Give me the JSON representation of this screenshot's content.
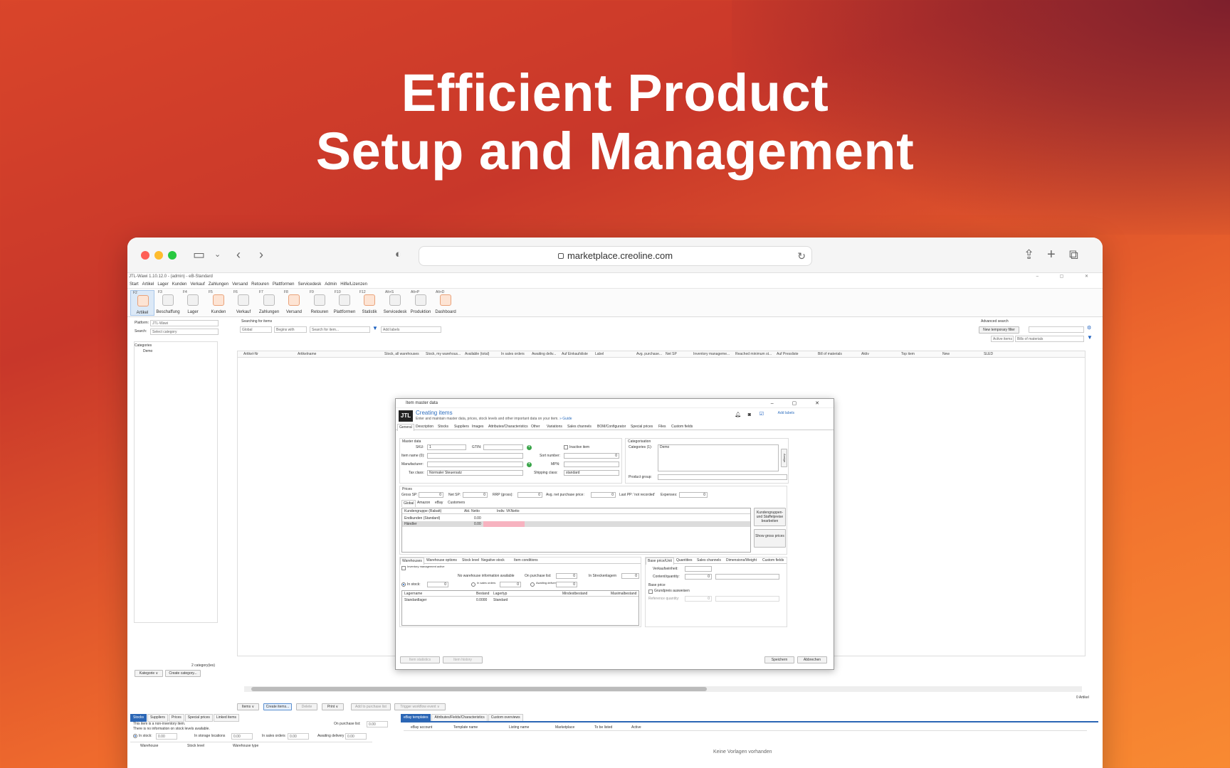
{
  "headline": {
    "line1": "Efficient Product",
    "line2": "Setup and Management"
  },
  "browser": {
    "url": "marketplace.creoline.com"
  },
  "app": {
    "title": "JTL-Wawi 1.10.12.0 - (admin) - eB-Standard",
    "window_controls": "– ▢ ✕",
    "menu": [
      "Start",
      "Artikel",
      "Lager",
      "Kunden",
      "Verkauf",
      "Zahlungen",
      "Versand",
      "Retouren",
      "Plattformen",
      "Servicedesk",
      "Admin",
      "Hilfe/Lizenzen"
    ],
    "ribbon": [
      {
        "key": "F2",
        "label": "Artikel"
      },
      {
        "key": "F3",
        "label": "Beschaffung"
      },
      {
        "key": "F4",
        "label": "Lager"
      },
      {
        "key": "F5",
        "label": "Kunden"
      },
      {
        "key": "F6",
        "label": "Verkauf"
      },
      {
        "key": "F7",
        "label": "Zahlungen"
      },
      {
        "key": "F8",
        "label": "Versand"
      },
      {
        "key": "F9",
        "label": "Retouren"
      },
      {
        "key": "F10",
        "label": "Plattformen"
      },
      {
        "key": "F12",
        "label": "Statistik"
      },
      {
        "key": "Alt+S",
        "label": "Servicedesk"
      },
      {
        "key": "Alt+P",
        "label": "Produktion"
      },
      {
        "key": "Alt+D",
        "label": "Dashboard"
      }
    ],
    "left": {
      "platform_label": "Platform:",
      "platform_value": "JTL-Wawi",
      "search_label": "Search:",
      "search_placeholder": "Select category",
      "categories_header": "Categories",
      "category_item": "Demo",
      "count": "2 category(ies)",
      "btn_kategorie": "Kategorie ∨",
      "btn_create_category": "Create category..."
    },
    "search": {
      "title": "Searching for items",
      "scope": "Global",
      "mode": "Begins with",
      "placeholder": "Search for item...",
      "labels_placeholder": "Add labels",
      "advanced": "Advanced search",
      "temp_filter": "New temporary filter",
      "active_items": "Active items",
      "bills": "Bills of materials"
    },
    "columns": [
      "Artikel-Nr",
      "Artikelname",
      "Stock, all warehouses",
      "Stock, my warehous...",
      "Available (total)",
      "In sales orders",
      "Awaiting deliv...",
      "Auf Einkaufsliste",
      "Label",
      "Avg. purchase...",
      "Net SP",
      "Inventory manageme...",
      "Reached minimum st...",
      "Auf Pressliste",
      "Bill of materials",
      "Aktiv",
      "Top item",
      "New",
      "SLED"
    ],
    "toolbar": {
      "items": "Items ∨",
      "create": "Create items...",
      "delete": "Delete",
      "print": "Print ∨",
      "add_list": "Add to purchase list",
      "workflow": "Trigger workflow event ∨",
      "count": "0 Artikel"
    },
    "dialog": {
      "title": "Item master data",
      "controls": "– ▢ ✕",
      "heading": "Creating items",
      "subtitle": "Enter and maintain master data, prices, stock levels and other important data on your item.",
      "guide": "» Guide",
      "add_labels": "Add labels",
      "tabs": [
        "General",
        "Description",
        "Stocks",
        "Suppliers",
        "Images",
        "Attributes/Characteristics",
        "Other",
        "Variations",
        "Sales channels",
        "BOM/Configurator",
        "Special prices",
        "Files",
        "Custom fields"
      ],
      "master": {
        "title": "Master data",
        "sku_label": "SKU:",
        "sku": "1",
        "gtin_label": "GTIN:",
        "inactive": "Inactive item",
        "name_label": "Item name (0):",
        "sort_label": "Sort number:",
        "sort": "0",
        "manufacturer_label": "Manufacturer:",
        "mpn_label": "MPN:",
        "tax_label": "Tax class:",
        "tax": "Normaler Steuersatz",
        "shipping_label": "Shipping class:",
        "shipping": "standard"
      },
      "categorisation": {
        "title": "Categorisation",
        "categories_label": "Categories (1):",
        "category": "Demo",
        "assign": "Assign",
        "group_label": "Product group:"
      },
      "prices": {
        "title": "Prices",
        "gross_label": "Gross SP:",
        "gross": "0",
        "net_label": "Net SP:",
        "net": "0",
        "rrp_label": "RRP (gross):",
        "rrp": "0",
        "avg_label": "Avg. net purchase price:",
        "avg": "0",
        "lastpp_label": "Last PP: 'not recorded'",
        "exp_label": "Expenses:",
        "exp": "0",
        "subtabs": [
          "Global",
          "Amazon",
          "eBay",
          "Customers"
        ],
        "table_cols": [
          "Kundengruppe (Rabatt)",
          "Akt. Netto",
          "Indiv. VKNetto"
        ],
        "rows": [
          {
            "name": "Endkunden (Standard)",
            "val": "0.00"
          },
          {
            "name": "Händler",
            "val": "0.00"
          }
        ],
        "btn_groups": "Kundengruppen- und Staffelpreise bearbeiten",
        "btn_gross": "Show gross prices"
      },
      "stock": {
        "tabs": [
          "Warehouses",
          "Warehouse options",
          "Stock level",
          "Negative stock",
          "Item conditions"
        ],
        "inventory_active": "Inventory management active",
        "no_info": "No warehouse information available",
        "on_purchase_label": "On purchase list:",
        "on_purchase": "0",
        "in_stock_label": "In stock:",
        "in_stock": "0",
        "in_sales_label": "In sales orders",
        "in_sales": "0",
        "awaiting_label": "Awaiting delivery",
        "awaiting": "0",
        "strecken_label": "In Streckenlagern",
        "strecken": "0",
        "cols": [
          "Lagername",
          "Bestand",
          "Lagertyp",
          "Mindestbestand",
          "Maximalbestand"
        ],
        "row": {
          "name": "Standardlager",
          "bestand": "0.0000",
          "typ": "Standard"
        }
      },
      "baseprice": {
        "tabs": [
          "Base price/Unit",
          "Quantities",
          "Sales channels",
          "Dimensions/Weight",
          "Custom fields"
        ],
        "unit_label": "Verkaufseinheit:",
        "content_label": "Content/quantity:",
        "content": "0",
        "base_title": "Base price",
        "show": "Grundpreis ausweisen",
        "ref_label": "Reference quantity:",
        "ref": "0"
      },
      "footer": {
        "stats": "Item statistics",
        "history": "Item history",
        "save": "Speichern",
        "cancel": "Abbrechen"
      }
    },
    "bottom_left": {
      "tabs": [
        "Stocks",
        "Suppliers",
        "Prices",
        "Special prices",
        "Linked items"
      ],
      "line1": "This item is a non-inventory item.",
      "line2": "There is no information on stock levels available.",
      "on_purchase_label": "On purchase list:",
      "on_purchase": "0.00",
      "in_stock_label": "In stock:",
      "in_stock": "0.00",
      "in_storage_label": "In storage locations",
      "in_storage": "0.00",
      "in_sales_label": "In sales orders",
      "in_sales": "0.00",
      "awaiting_label": "Awaiting delivery",
      "awaiting": "0.00",
      "cols": [
        "Warehouse",
        "Stock level",
        "Warehouse type"
      ]
    },
    "bottom_right": {
      "tabs": [
        "eBay templates",
        "Attributes/Fields/Characteristics",
        "Custom overviews"
      ],
      "cols": [
        "eBay account",
        "Template name",
        "Listing name",
        "Marketplace",
        "To be listed",
        "Active"
      ],
      "empty": "Keine Vorlagen vorhanden"
    }
  }
}
